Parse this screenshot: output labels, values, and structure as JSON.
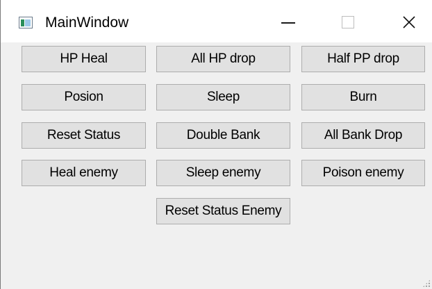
{
  "window": {
    "title": "MainWindow",
    "icon": "app-window-icon",
    "controls": {
      "minimize_icon": "minimize-icon",
      "maximize_icon": "maximize-icon",
      "close_icon": "close-icon",
      "close_glyph": "✕"
    }
  },
  "buttons": {
    "hp_heal": "HP Heal",
    "all_hp_drop": "All HP drop",
    "half_pp_drop": "Half PP drop",
    "posion": "Posion",
    "sleep": "Sleep",
    "burn": "Burn",
    "reset_status": "Reset Status",
    "double_bank": "Double Bank",
    "all_bank_drop": "All Bank Drop",
    "heal_enemy": "Heal enemy",
    "sleep_enemy": "Sleep enemy",
    "poison_enemy": "Poison enemy",
    "reset_status_enemy": "Reset Status Enemy"
  }
}
